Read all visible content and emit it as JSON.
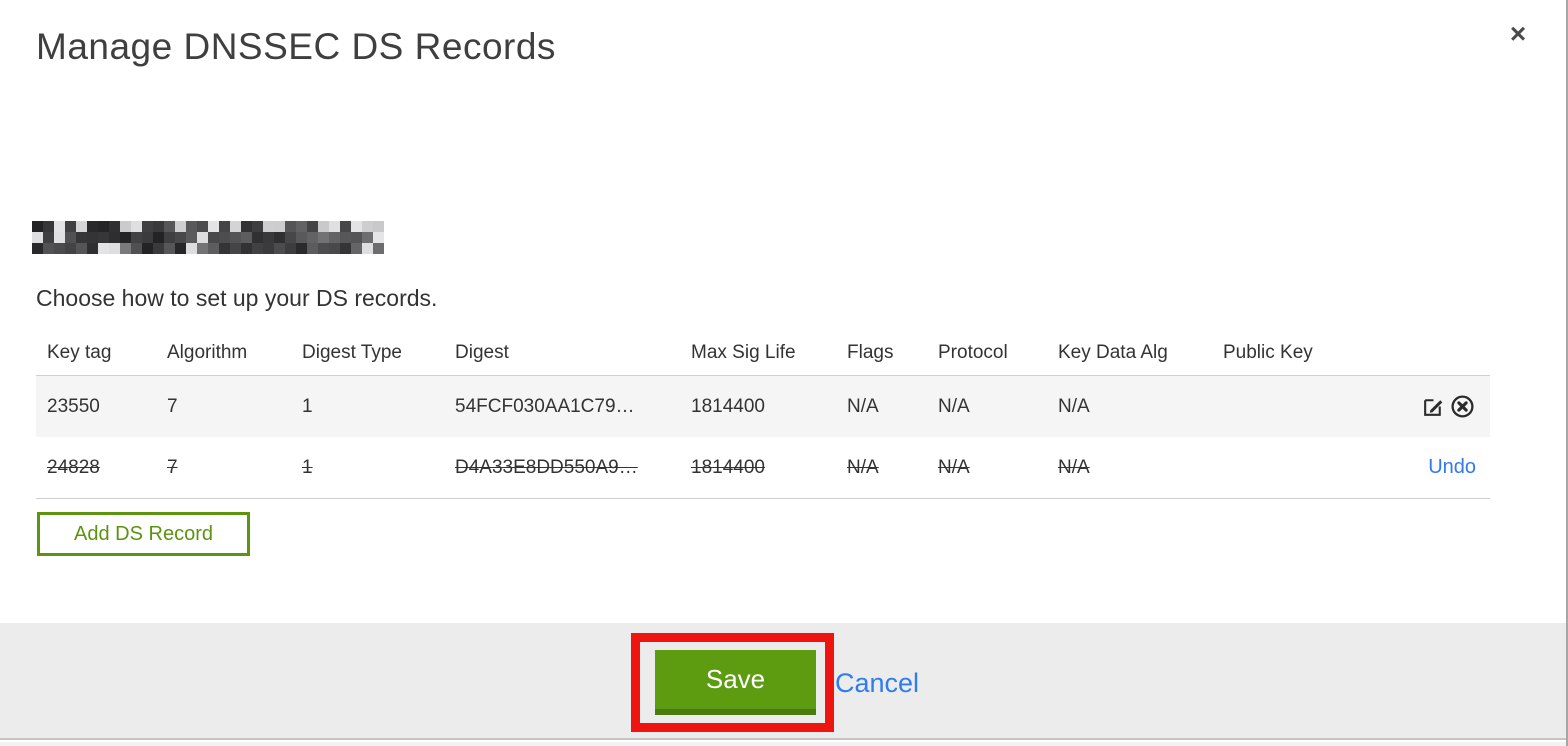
{
  "modal": {
    "title": "Manage DNSSEC DS Records",
    "close_glyph": "×"
  },
  "domain_redacted": true,
  "subtitle": "Choose how to set up your DS records.",
  "table": {
    "headers": [
      "Key tag",
      "Algorithm",
      "Digest Type",
      "Digest",
      "Max Sig Life",
      "Flags",
      "Protocol",
      "Key Data Alg",
      "Public Key"
    ],
    "rows": [
      {
        "cells": [
          "23550",
          "7",
          "1",
          "54FCF030AA1C79…",
          "1814400",
          "N/A",
          "N/A",
          "N/A",
          ""
        ],
        "deleted": false,
        "actions": [
          "edit-icon",
          "delete-circle-x-icon"
        ]
      },
      {
        "cells": [
          "24828",
          "7",
          "1",
          "D4A33E8DD550A9…",
          "1814400",
          "N/A",
          "N/A",
          "N/A",
          ""
        ],
        "deleted": true,
        "action_label": "Undo"
      }
    ]
  },
  "buttons": {
    "add_label": "Add DS Record",
    "save_label": "Save",
    "cancel_label": "Cancel"
  },
  "colors": {
    "green": "#5d9b10",
    "green_dark": "#4a7b0e",
    "link_blue": "#3478f0",
    "annotation_red": "#ee1510",
    "footer_gray": "#ececec",
    "row_stripe": "#f5f5f5"
  }
}
